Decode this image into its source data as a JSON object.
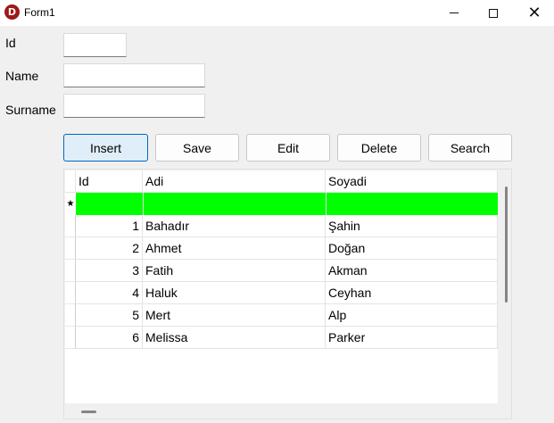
{
  "window": {
    "title": "Form1",
    "icon_letter": "D",
    "minimize_glyph": "",
    "maximize_glyph": "",
    "close_glyph": "✕"
  },
  "form": {
    "id_label": "Id",
    "id_value": "",
    "name_label": "Name",
    "name_value": "",
    "surname_label": "Surname",
    "surname_value": ""
  },
  "buttons": {
    "insert": "Insert",
    "save": "Save",
    "edit": "Edit",
    "delete": "Delete",
    "search": "Search"
  },
  "grid": {
    "columns": [
      "Id",
      "Adi",
      "Soyadi"
    ],
    "new_row_marker": "★",
    "new_row_color": "#00ff00",
    "rows": [
      {
        "id": "1",
        "adi": "Bahadır",
        "soyadi": "Şahin"
      },
      {
        "id": "2",
        "adi": "Ahmet",
        "soyadi": "Doğan"
      },
      {
        "id": "3",
        "adi": "Fatih",
        "soyadi": "Akman"
      },
      {
        "id": "4",
        "adi": "Haluk",
        "soyadi": "Ceyhan"
      },
      {
        "id": "5",
        "adi": "Mert",
        "soyadi": "Alp"
      },
      {
        "id": "6",
        "adi": "Melissa",
        "soyadi": "Parker"
      }
    ]
  },
  "colors": {
    "accent": "#0067c0",
    "default_button_bg": "#e0eef9",
    "app_icon": "#a01818"
  }
}
